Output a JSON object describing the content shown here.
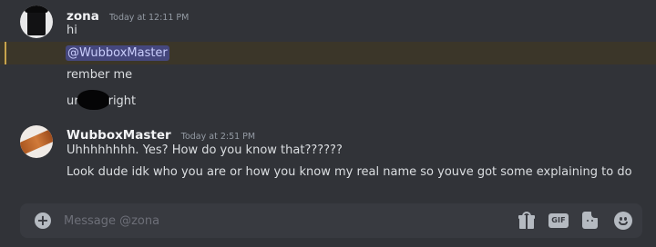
{
  "messages": [
    {
      "author": "zona",
      "timestamp": "Today at 12:11 PM",
      "avatar_icon": "avatar-dark-figure-icon",
      "lines": [
        {
          "text": "hi"
        },
        {
          "mention": "@WubboxMaster",
          "highlighted": true
        },
        {
          "text": "rember me"
        },
        {
          "prefix": "ur",
          "suffix": "right",
          "redacted": true
        }
      ]
    },
    {
      "author": "WubboxMaster",
      "timestamp": "Today at 2:51 PM",
      "avatar_icon": "avatar-orange-streak-icon",
      "lines": [
        {
          "text": "Uhhhhhhhh. Yes? How do you know that??????"
        },
        {
          "text": "Look dude idk who you are or how you know my real name so youve got some explaining to do"
        }
      ]
    }
  ],
  "composer": {
    "placeholder": "Message @zona",
    "value": "",
    "gif_label": "GIF",
    "icons": [
      "plus-icon",
      "gift-icon",
      "gif-icon",
      "sticker-icon",
      "emoji-icon"
    ]
  },
  "colors": {
    "background": "#313338",
    "mention_row": "#3b3629",
    "mention_bar": "#c7a34d",
    "mention_pill": "#45477d",
    "composer": "#383a40"
  }
}
